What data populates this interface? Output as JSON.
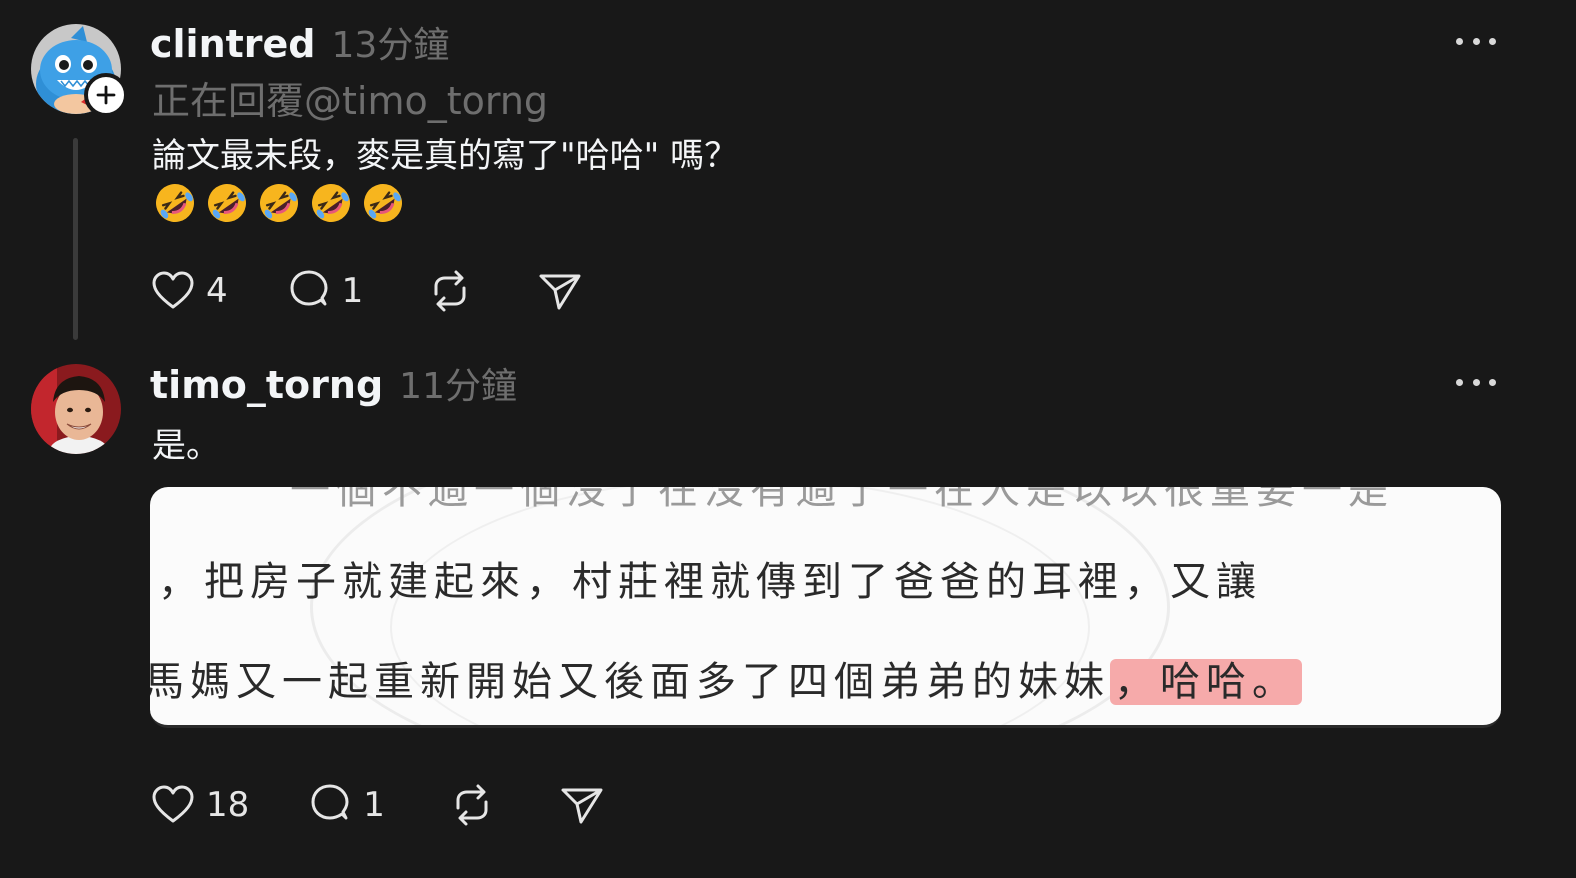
{
  "posts": [
    {
      "username": "clintred",
      "time": "13分鐘",
      "reply_to": "正在回覆@timo_torng",
      "text": "論文最末段，麥是真的寫了\"哈哈\" 嗎？",
      "emoji_count": 5,
      "emoji_name": "rolling-on-floor-laughing",
      "likes": "4",
      "replies": "1"
    },
    {
      "username": "timo_torng",
      "time": "11分鐘",
      "text": "是。",
      "likes": "18",
      "replies": "1",
      "image": {
        "line_top": "一個不過一個沒了在沒有過了一在人是以以很重要一是",
        "line_1": "，把房子就建起來，村莊裡就傳到了爸爸的耳裡，又讓",
        "line_2_prefix": "馬媽又一起重新開始又後面多了四個弟弟的妹妹",
        "line_2_highlight": "，哈哈。"
      }
    }
  ],
  "icons": [
    "heart-icon",
    "comment-icon",
    "repost-icon",
    "share-icon",
    "more-icon",
    "plus-icon"
  ],
  "colors": {
    "background": "#181818",
    "text": "#f3f5f7",
    "muted": "#6e6e6e",
    "highlight": "#f6aaaa"
  }
}
